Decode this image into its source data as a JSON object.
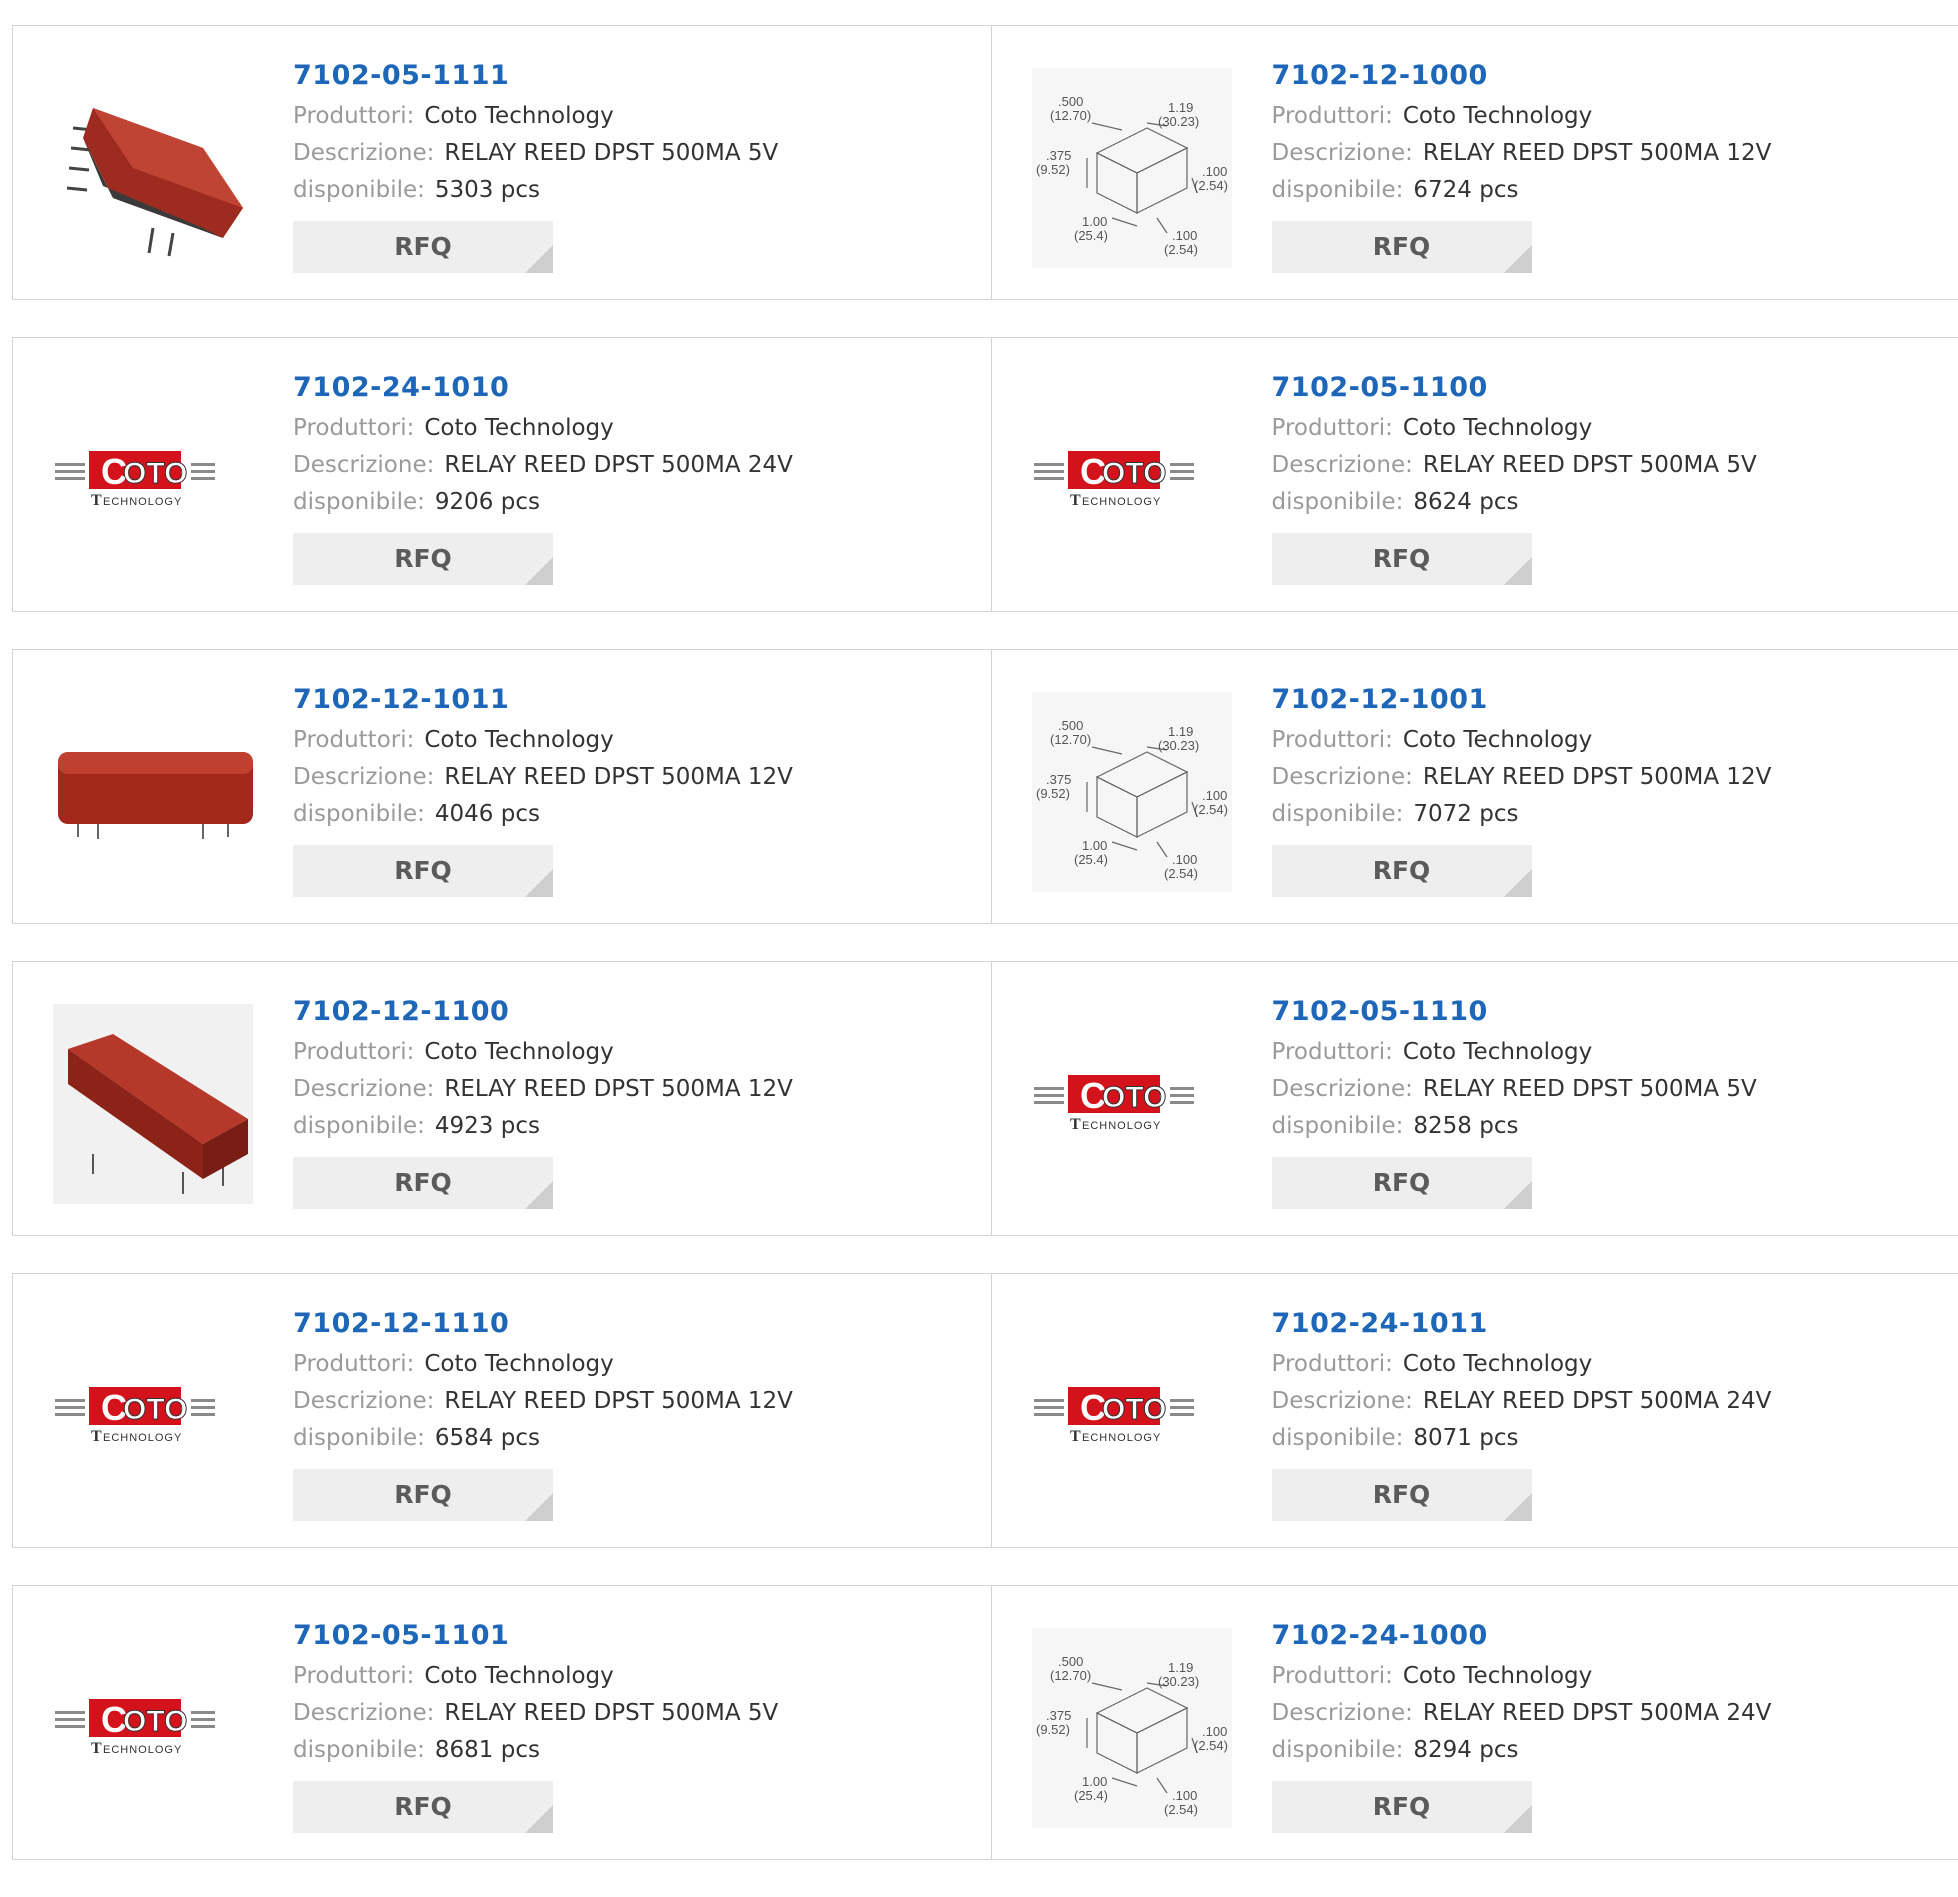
{
  "labels": {
    "manufacturer": "Produttori:",
    "description": "Descrizione:",
    "available": "disponibile:",
    "rfq": "RFQ",
    "units": "pcs"
  },
  "logo": {
    "brand": "OTO",
    "sub": "ECHNOLOGY",
    "prefix": "C",
    "subprefix": "T"
  },
  "diagram": {
    "d1": ".500",
    "d1mm": "(12.70)",
    "d2": "1.19",
    "d2mm": "(30.23)",
    "d3": ".375",
    "d3mm": "(9.52)",
    "d4": ".100",
    "d4mm": "(2.54)",
    "d5": "1.00",
    "d5mm": "(25.4)",
    "d6": ".100",
    "d6mm": "(2.54)"
  },
  "products": [
    {
      "part": "7102-05-1111",
      "manufacturer": "Coto Technology",
      "description": "RELAY REED DPST 500MA 5V",
      "stock": "5303 pcs",
      "image": "relay-photo-angled"
    },
    {
      "part": "7102-12-1000",
      "manufacturer": "Coto Technology",
      "description": "RELAY REED DPST 500MA 12V",
      "stock": "6724 pcs",
      "image": "dimension-diagram"
    },
    {
      "part": "7102-24-1010",
      "manufacturer": "Coto Technology",
      "description": "RELAY REED DPST 500MA 24V",
      "stock": "9206 pcs",
      "image": "coto-logo"
    },
    {
      "part": "7102-05-1100",
      "manufacturer": "Coto Technology",
      "description": "RELAY REED DPST 500MA 5V",
      "stock": "8624 pcs",
      "image": "coto-logo"
    },
    {
      "part": "7102-12-1011",
      "manufacturer": "Coto Technology",
      "description": "RELAY REED DPST 500MA 12V",
      "stock": "4046 pcs",
      "image": "relay-photo-side"
    },
    {
      "part": "7102-12-1001",
      "manufacturer": "Coto Technology",
      "description": "RELAY REED DPST 500MA 12V",
      "stock": "7072 pcs",
      "image": "dimension-diagram"
    },
    {
      "part": "7102-12-1100",
      "manufacturer": "Coto Technology",
      "description": "RELAY REED DPST 500MA 12V",
      "stock": "4923 pcs",
      "image": "relay-photo-top"
    },
    {
      "part": "7102-05-1110",
      "manufacturer": "Coto Technology",
      "description": "RELAY REED DPST 500MA 5V",
      "stock": "8258 pcs",
      "image": "coto-logo"
    },
    {
      "part": "7102-12-1110",
      "manufacturer": "Coto Technology",
      "description": "RELAY REED DPST 500MA 12V",
      "stock": "6584 pcs",
      "image": "coto-logo"
    },
    {
      "part": "7102-24-1011",
      "manufacturer": "Coto Technology",
      "description": "RELAY REED DPST 500MA 24V",
      "stock": "8071 pcs",
      "image": "coto-logo"
    },
    {
      "part": "7102-05-1101",
      "manufacturer": "Coto Technology",
      "description": "RELAY REED DPST 500MA 5V",
      "stock": "8681 pcs",
      "image": "coto-logo"
    },
    {
      "part": "7102-24-1000",
      "manufacturer": "Coto Technology",
      "description": "RELAY REED DPST 500MA 24V",
      "stock": "8294 pcs",
      "image": "dimension-diagram"
    }
  ]
}
